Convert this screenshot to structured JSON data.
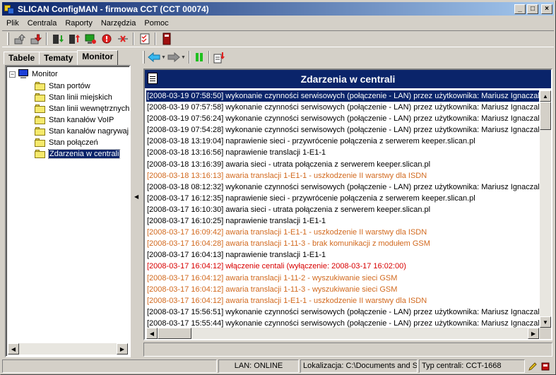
{
  "window": {
    "title": "SLICAN ConfigMAN - firmowa CCT (CCT 00074)",
    "minimize_label": "_",
    "maximize_label": "□",
    "close_label": "×"
  },
  "menu": [
    "Plik",
    "Centrala",
    "Raporty",
    "Narzędzia",
    "Pomoc"
  ],
  "tabs": [
    {
      "label": "Tabele",
      "active": false
    },
    {
      "label": "Tematy",
      "active": false
    },
    {
      "label": "Monitor",
      "active": true
    }
  ],
  "tree": {
    "expander": "−",
    "root": "Monitor",
    "items": [
      "Stan portów",
      "Stan linii miejskich",
      "Stan linii wewnętrznych",
      "Stan kanałów VoIP",
      "Stan kanałów nagrywaj",
      "Stan połączeń",
      "Zdarzenia w centrali"
    ],
    "selected_index": 6
  },
  "events_panel": {
    "title": "Zdarzenia w centrali",
    "rows": [
      {
        "text": "[2008-03-19 07:58:50] wykonanie czynności serwisowych (połączenie - LAN)  przez użytkownika: Mariusz Ignaczak -",
        "style": "sel"
      },
      {
        "text": "[2008-03-19 07:57:58] wykonanie czynności serwisowych (połączenie - LAN)  przez użytkownika: Mariusz Ignaczak -",
        "style": "normal"
      },
      {
        "text": "[2008-03-19 07:56:24] wykonanie czynności serwisowych (połączenie - LAN)  przez użytkownika: Mariusz Ignaczak -",
        "style": "normal"
      },
      {
        "text": "[2008-03-19 07:54:28] wykonanie czynności serwisowych (połączenie - LAN)  przez użytkownika: Mariusz Ignaczak -",
        "style": "normal"
      },
      {
        "text": "[2008-03-18 13:19:04] naprawienie sieci - przywrócenie połączenia z serwerem keeper.slican.pl",
        "style": "normal"
      },
      {
        "text": "[2008-03-18 13:16:56] naprawienie translacji 1-E1-1",
        "style": "normal"
      },
      {
        "text": "[2008-03-18 13:16:39] awaria sieci - utrata połączenia z serwerem keeper.slican.pl",
        "style": "normal"
      },
      {
        "text": "[2008-03-18 13:16:13] awaria translacji 1-E1-1 - uszkodzenie II warstwy dla ISDN",
        "style": "warn"
      },
      {
        "text": "[2008-03-18 08:12:32] wykonanie czynności serwisowych (połączenie - LAN)  przez użytkownika: Mariusz Ignaczak -",
        "style": "normal"
      },
      {
        "text": "[2008-03-17 16:12:35] naprawienie sieci - przywrócenie połączenia z serwerem keeper.slican.pl",
        "style": "normal"
      },
      {
        "text": "[2008-03-17 16:10:30] awaria sieci - utrata połączenia z serwerem keeper.slican.pl",
        "style": "normal"
      },
      {
        "text": "[2008-03-17 16:10:25] naprawienie translacji 1-E1-1",
        "style": "normal"
      },
      {
        "text": "[2008-03-17 16:09:42] awaria translacji 1-E1-1 - uszkodzenie II warstwy dla ISDN",
        "style": "warn"
      },
      {
        "text": "[2008-03-17 16:04:28] awaria translacji 1-11-3 - brak komunikacji z modułem GSM",
        "style": "warn"
      },
      {
        "text": "[2008-03-17 16:04:13] naprawienie translacji 1-E1-1",
        "style": "normal"
      },
      {
        "text": "[2008-03-17 16:04:12] włączenie centali (wyłączenie: 2008-03-17 16:02:00)",
        "style": "red"
      },
      {
        "text": "[2008-03-17 16:04:12] awaria translacji 1-11-2 - wyszukiwanie sieci GSM",
        "style": "warn"
      },
      {
        "text": "[2008-03-17 16:04:12] awaria translacji 1-11-3 - wyszukiwanie sieci GSM",
        "style": "warn"
      },
      {
        "text": "[2008-03-17 16:04:12] awaria translacji 1-E1-1 - uszkodzenie II warstwy dla ISDN",
        "style": "warn"
      },
      {
        "text": "[2008-03-17 15:56:51] wykonanie czynności serwisowych (połączenie - LAN)  przez użytkownika: Mariusz Ignaczak -",
        "style": "normal"
      },
      {
        "text": "[2008-03-17 15:55:44] wykonanie czynności serwisowych (połączenie - LAN)  przez użytkownika: Mariusz Ignaczak -",
        "style": "normal"
      }
    ]
  },
  "statusbar": {
    "connection": "LAN: ONLINE",
    "location": "Lokalizacja: C:\\Documents and Se",
    "device_type": "Typ centrali: CCT-1668"
  },
  "icons": {
    "toolbar": [
      "upload-icon",
      "download-icon",
      "read-config-icon",
      "write-config-icon",
      "connect-icon",
      "stop-icon",
      "disconnect-icon",
      "checklist-icon",
      "device-icon"
    ],
    "monitor_toolbar": [
      "back-arrow-icon",
      "forward-arrow-icon",
      "pause-icon",
      "export-icon"
    ]
  },
  "colors": {
    "selection": "#0a246a",
    "warning_text": "#d2691e",
    "alert_text": "#d80000"
  }
}
